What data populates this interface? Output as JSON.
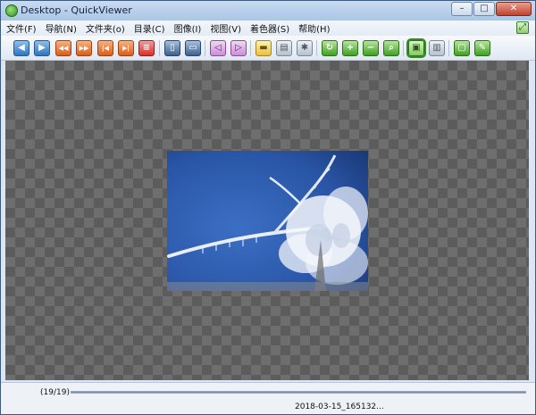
{
  "window": {
    "title": "Desktop - QuickViewer",
    "caption_buttons": {
      "minimize": "–",
      "maximize": "□",
      "close": "✕"
    }
  },
  "menu": {
    "items": [
      "文件(F)",
      "导航(N)",
      "文件夹(o)",
      "目录(C)",
      "图像(I)",
      "视图(V)",
      "着色器(S)",
      "帮助(H)"
    ],
    "corner_icon": "expand-icon"
  },
  "toolbar": {
    "buttons": [
      {
        "icon": "prev-icon",
        "glyph": "◀"
      },
      {
        "icon": "next-icon",
        "glyph": "▶"
      },
      {
        "icon": "rewind-icon",
        "glyph": "◀◀"
      },
      {
        "icon": "fast-forward-icon",
        "glyph": "▶▶"
      },
      {
        "icon": "first-icon",
        "glyph": "|◀"
      },
      {
        "icon": "last-icon",
        "glyph": "▶|"
      },
      {
        "icon": "list-icon",
        "glyph": "≡"
      },
      {
        "icon": "single-page-icon",
        "glyph": "▯"
      },
      {
        "icon": "spread-page-icon",
        "glyph": "▭"
      },
      {
        "icon": "page-left-icon",
        "glyph": "◁"
      },
      {
        "icon": "page-right-icon",
        "glyph": "▷"
      },
      {
        "icon": "folder-icon",
        "glyph": "▬"
      },
      {
        "icon": "catalog-icon",
        "glyph": "▤"
      },
      {
        "icon": "settings-icon",
        "glyph": "✱"
      },
      {
        "icon": "rotate-icon",
        "glyph": "↻"
      },
      {
        "icon": "zoom-in-icon",
        "glyph": "+"
      },
      {
        "icon": "zoom-out-icon",
        "glyph": "−"
      },
      {
        "icon": "search-icon",
        "glyph": "⌕"
      },
      {
        "icon": "fit-window-icon",
        "glyph": "▣"
      },
      {
        "icon": "dual-view-icon",
        "glyph": "▥"
      },
      {
        "icon": "slideshow-icon",
        "glyph": "▢"
      },
      {
        "icon": "pin-icon",
        "glyph": "✎"
      }
    ]
  },
  "status": {
    "counter": "(19/19)",
    "progress": 1.0,
    "filename": "2018-03-15_165132..."
  },
  "colors": {
    "accent_green": "#2f8f1d",
    "canvas_dark": "#5c5c5c",
    "canvas_light": "#6e6e6e",
    "photo_sky": "#2a55a6"
  }
}
